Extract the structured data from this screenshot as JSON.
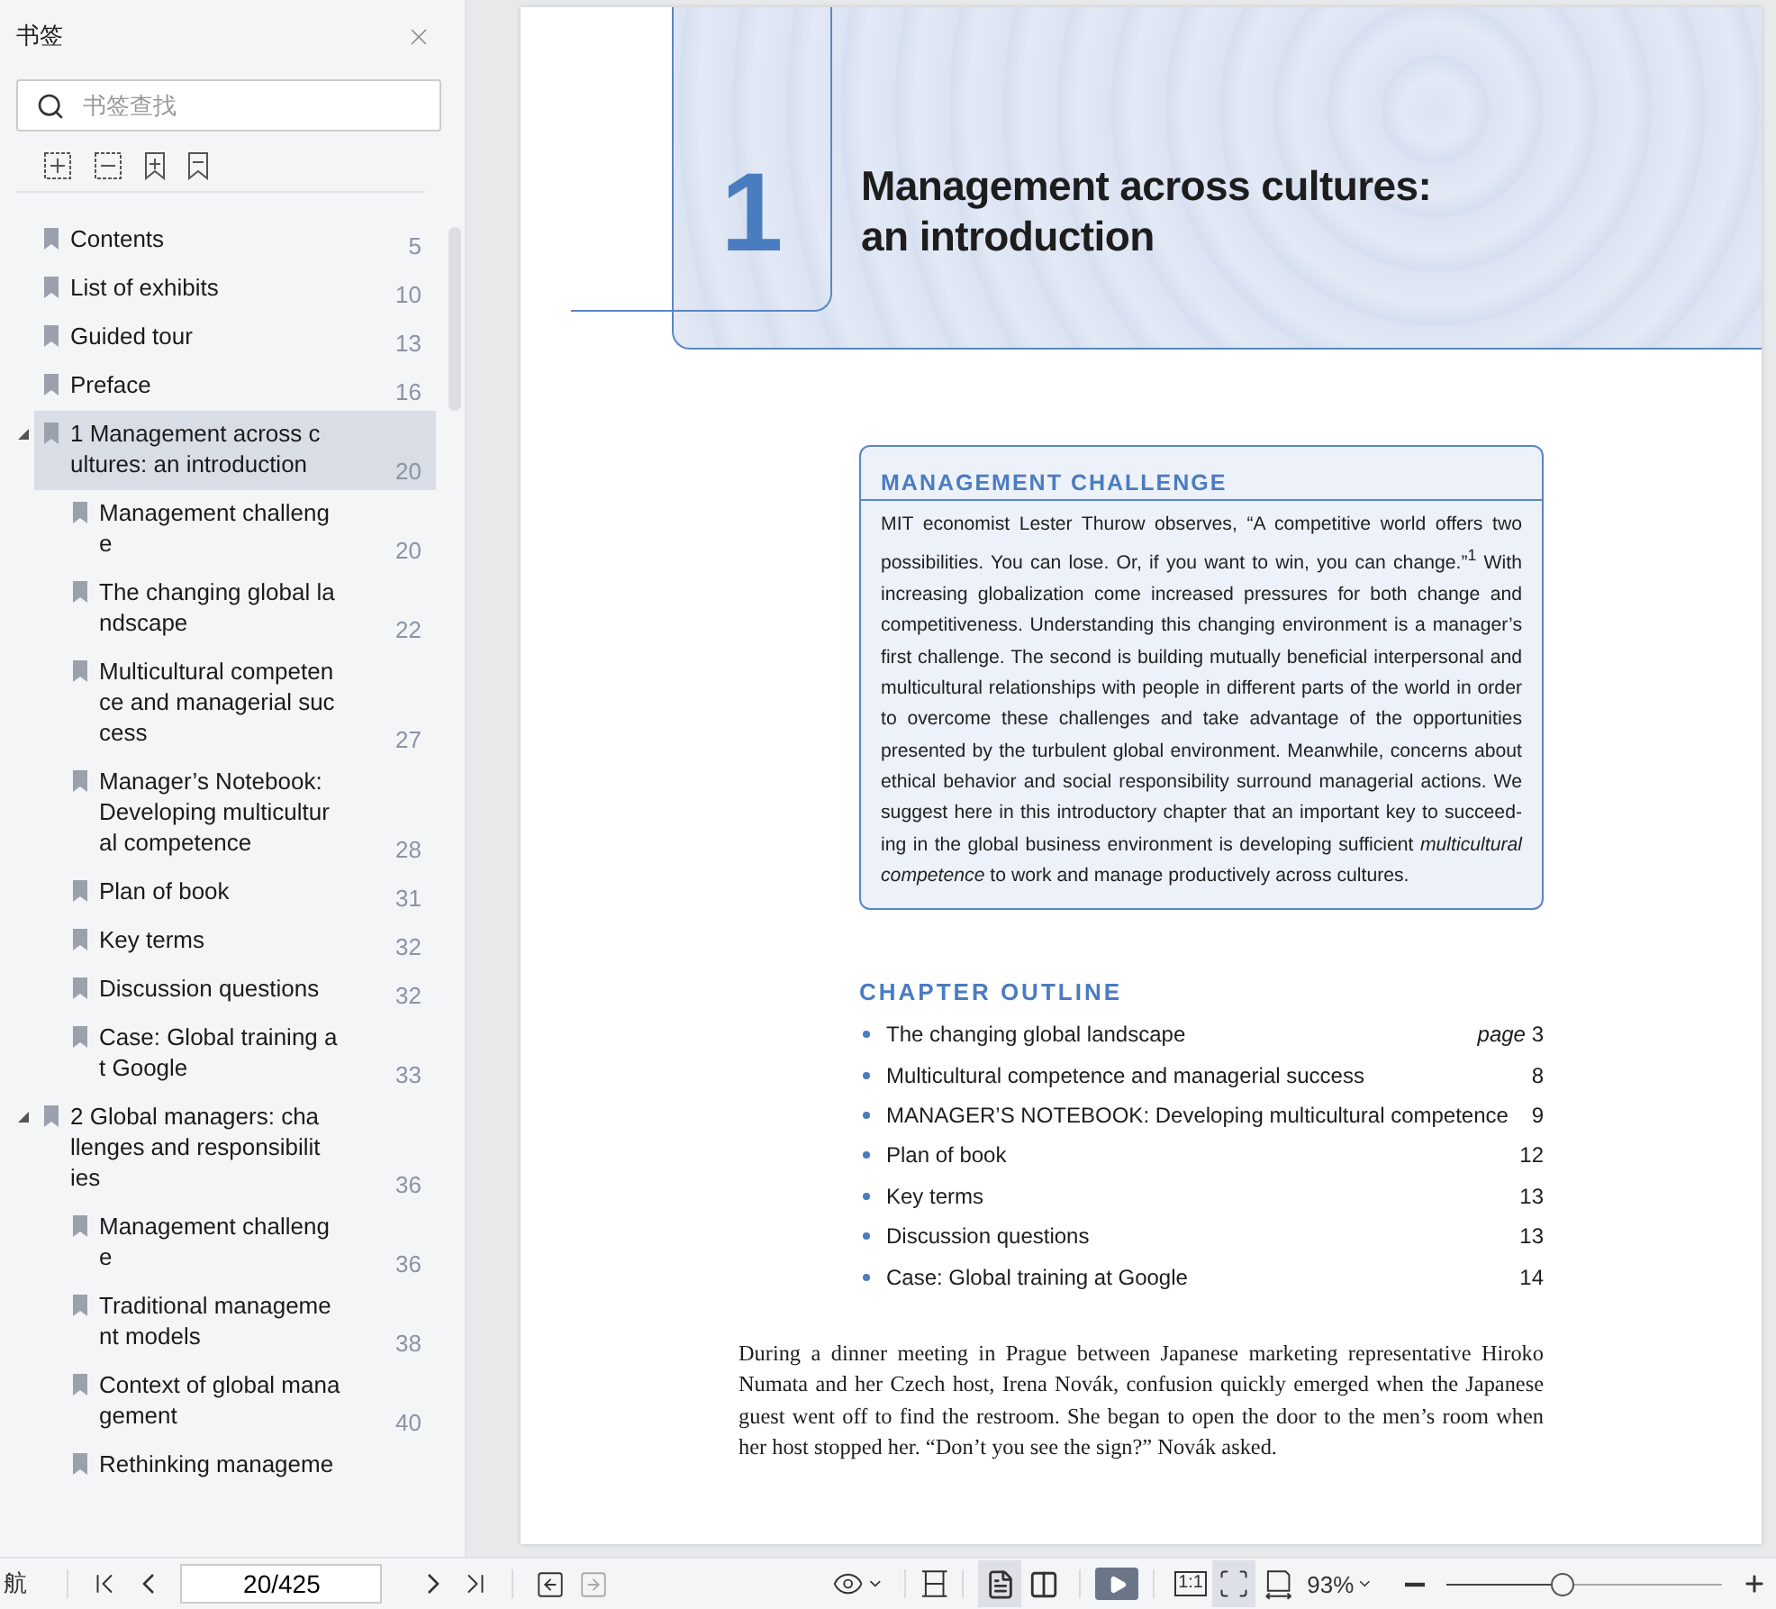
{
  "sidebar": {
    "title": "书签",
    "search": {
      "placeholder": "书签查找"
    },
    "bookmarks": [
      {
        "label": "Contents",
        "page": "5",
        "selected": false
      },
      {
        "label": "List of exhibits",
        "page": "10",
        "selected": false
      },
      {
        "label": "Guided tour",
        "page": "13",
        "selected": false
      },
      {
        "label": "Preface",
        "page": "16",
        "selected": false
      },
      {
        "label": "1 Management across cultures: an introduction",
        "page": "20",
        "selected": true,
        "expanded": true,
        "children": [
          {
            "label": "Management challenge",
            "page": "20",
            "selected": false
          },
          {
            "label": "The changing global landscape",
            "page": "22",
            "selected": false
          },
          {
            "label": "Multicultural competence and managerial success",
            "page": "27",
            "selected": false
          },
          {
            "label": "Manager’s Notebook: Developing multicultural competence",
            "page": "28",
            "selected": false
          },
          {
            "label": "Plan of book",
            "page": "31",
            "selected": false
          },
          {
            "label": "Key terms",
            "page": "32",
            "selected": false
          },
          {
            "label": "Discussion questions",
            "page": "32",
            "selected": false
          },
          {
            "label": "Case: Global training at Google",
            "page": "33",
            "selected": false
          }
        ]
      },
      {
        "label": "2 Global managers: challenges and responsibilities",
        "page": "36",
        "selected": false,
        "expanded": true,
        "children": [
          {
            "label": "Management challenge",
            "page": "36",
            "selected": false
          },
          {
            "label": "Traditional management models",
            "page": "38",
            "selected": false
          },
          {
            "label": "Context of global management",
            "page": "40",
            "selected": false
          },
          {
            "label": "Rethinking manageme",
            "selected": false
          }
        ]
      }
    ]
  },
  "page": {
    "chapter_number": "1",
    "chapter_title": "Management across cultures: an introduction",
    "challenge": {
      "heading": "MANAGEMENT CHALLENGE",
      "text": "MIT economist Lester Thurow observes, “A competitive world offers two possibilities. You can lose. Or, if you want to win, you can change.”$^{1}$ With increasing globalization come increased pressures for both change and competitiveness. Understanding this changing environment is a manager’s first challenge. The second is building mutually beneficial interpersonal and multicultural relationships with people in different parts of the world in order to overcome these challenges and take advantage of the opportunities presented by the turbulent global environment. Meanwhile, concerns about ethical behavior and social responsibility surround managerial actions. We suggest here in this introductory chapter that an important key to succeed-ing in the global business environment is developing sufficient *multicultural competence* to work and manage productively across cultures."
    },
    "outline": {
      "heading": "CHAPTER OUTLINE",
      "items": [
        {
          "label": "The changing global landscape",
          "page": "*page* 3"
        },
        {
          "label": "Multicultural competence and managerial success",
          "page": "8"
        },
        {
          "label": "MANAGER’S NOTEBOOK: Developing multicultural competence",
          "page": "9"
        },
        {
          "label": "Plan of book",
          "page": "12"
        },
        {
          "label": "Key terms",
          "page": "13"
        },
        {
          "label": "Discussion questions",
          "page": "13"
        },
        {
          "label": "Case: Global training at Google",
          "page": "14"
        }
      ]
    },
    "paragraph": "During a dinner meeting in Prague between Japanese marketing representative Hiroko Numata and her Czech host, Irena Novák, confusion quickly emerged when the Japanese guest went off to find the restroom. She began to open the door to the men’s room when her host stopped her. “Don’t you see the sign?” Novák asked."
  },
  "bottom_bar": {
    "nav_label": "航",
    "page_field": "20/425",
    "back_disabled": false,
    "forward_disabled": true,
    "view_modes": [
      {
        "kind": "single",
        "selected": true
      },
      {
        "kind": "double",
        "selected": false
      }
    ],
    "fit_modes": [
      {
        "kind": "actual",
        "label": "1:1",
        "selected": false
      },
      {
        "kind": "page",
        "selected": true
      }
    ],
    "zoom": "93%",
    "zoom_slider": {
      "level": 0.42
    }
  }
}
